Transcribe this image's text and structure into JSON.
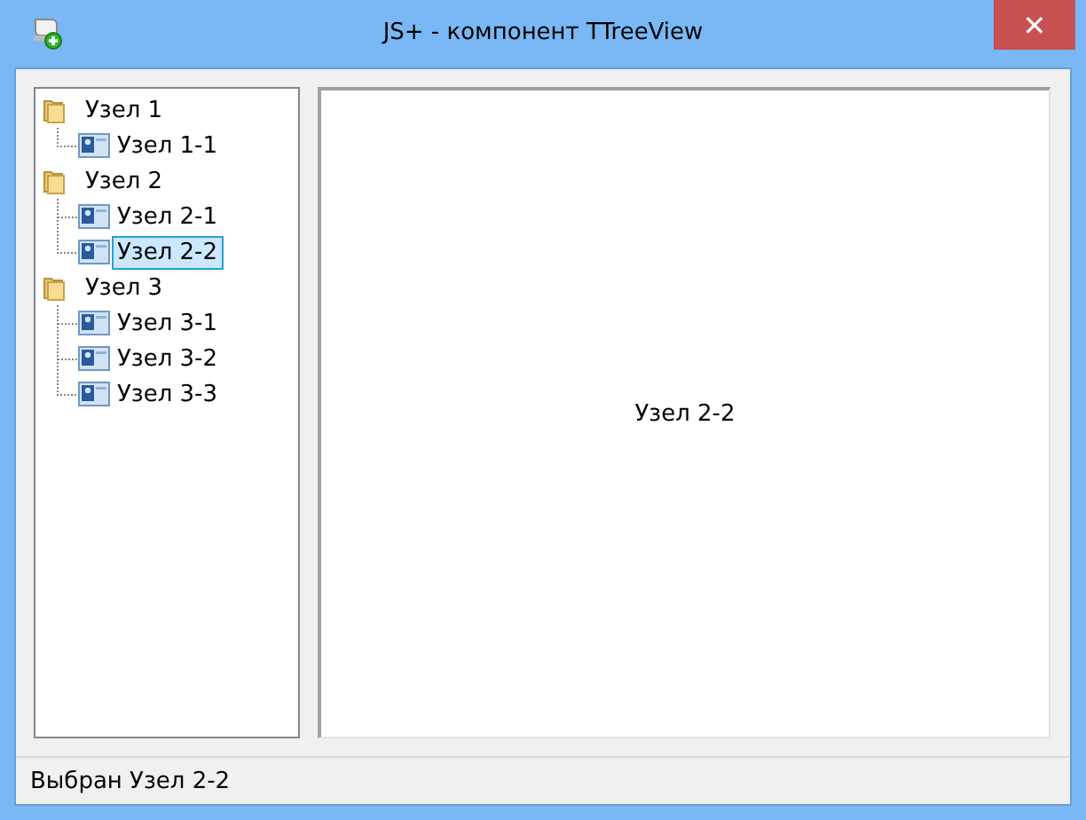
{
  "window": {
    "title": "JS+ - компонент TTreeView",
    "close": "✕"
  },
  "tree": [
    {
      "label": "Узел 1",
      "children": [
        {
          "label": "Узел 1-1",
          "selected": false
        }
      ]
    },
    {
      "label": "Узел 2",
      "children": [
        {
          "label": "Узел 2-1",
          "selected": false
        },
        {
          "label": "Узел 2-2",
          "selected": true
        }
      ]
    },
    {
      "label": "Узел 3",
      "children": [
        {
          "label": "Узел 3-1",
          "selected": false
        },
        {
          "label": "Узел 3-2",
          "selected": false
        },
        {
          "label": "Узел 3-3",
          "selected": false
        }
      ]
    }
  ],
  "detail": {
    "text": "Узел 2-2"
  },
  "status_bar": "Выбран Узел 2-2"
}
